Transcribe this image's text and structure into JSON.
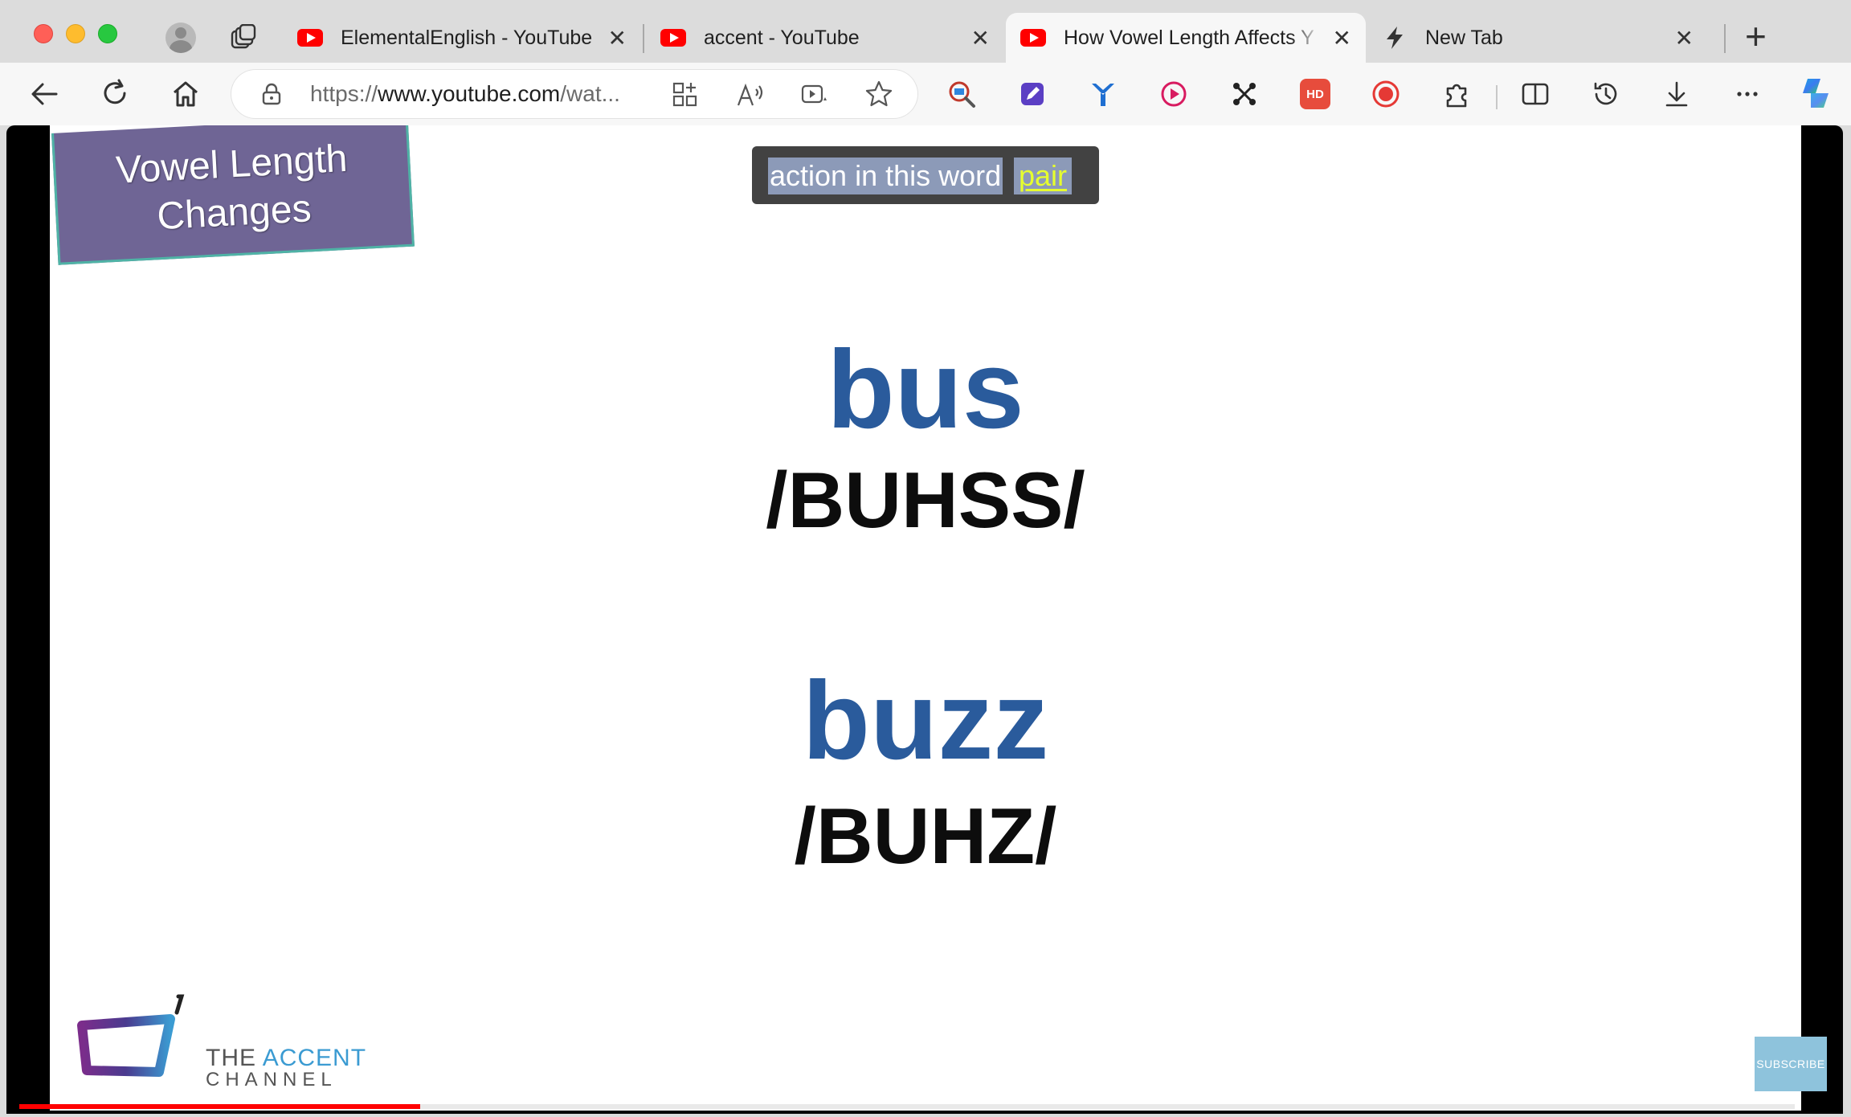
{
  "browser": {
    "tabs": [
      {
        "title": "ElementalEnglish - YouTube",
        "icon": "youtube-icon",
        "active": false
      },
      {
        "title": "accent - YouTube",
        "icon": "youtube-icon",
        "active": false
      },
      {
        "title": "How Vowel Length Affects Y",
        "icon": "youtube-icon",
        "active": true
      },
      {
        "title": "New Tab",
        "icon": "bolt-icon",
        "active": false
      }
    ],
    "tab_close_glyph": "✕",
    "new_tab_glyph": "+",
    "url_scheme": "https://",
    "url_host": "www.youtube.com",
    "url_rest": "/wat...",
    "extension_badge_hd": "HD"
  },
  "video": {
    "badge_line1": "Vowel Length",
    "badge_line2": "Changes",
    "caption_text": "action in this word",
    "caption_highlight": "pair",
    "word1": "bus",
    "pron1": "/BUHSS/",
    "word2": "buzz",
    "pron2": "/BUHZ/",
    "logo_text_the": "THE ",
    "logo_text_accent": "ACCENT",
    "logo_text_channel": "CHANNEL",
    "subscribe_label": "SUBSCRIBE",
    "progress_fraction": 0.226
  },
  "colors": {
    "youtube_red": "#ff0000",
    "word_blue": "#2a5b9c",
    "caption_highlight": "#e6ff2e",
    "badge_purple": "#6f6595"
  }
}
